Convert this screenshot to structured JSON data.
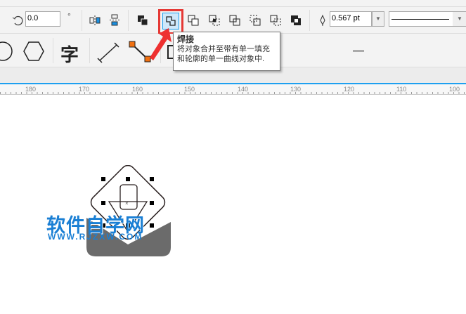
{
  "toolbar": {
    "rotation_value": "0.0",
    "degree_symbol": "°",
    "outline_width": "0.567 pt"
  },
  "tooltip": {
    "title": "焊接",
    "description": "将对象合并至带有单一填充和轮廓的单一曲线对象中."
  },
  "toolbox": {
    "text_tool_glyph": "字"
  },
  "ruler": {
    "ticks": [
      "180",
      "170",
      "160",
      "150",
      "140",
      "130",
      "120",
      "110",
      "100"
    ]
  },
  "canvas": {
    "watermark_title": "软件自学网",
    "watermark_url": "WWW.RJZXW.COM"
  },
  "colors": {
    "highlight": "#e53935",
    "accent": "#1ea0f0",
    "watermark": "#1a7fd4"
  }
}
